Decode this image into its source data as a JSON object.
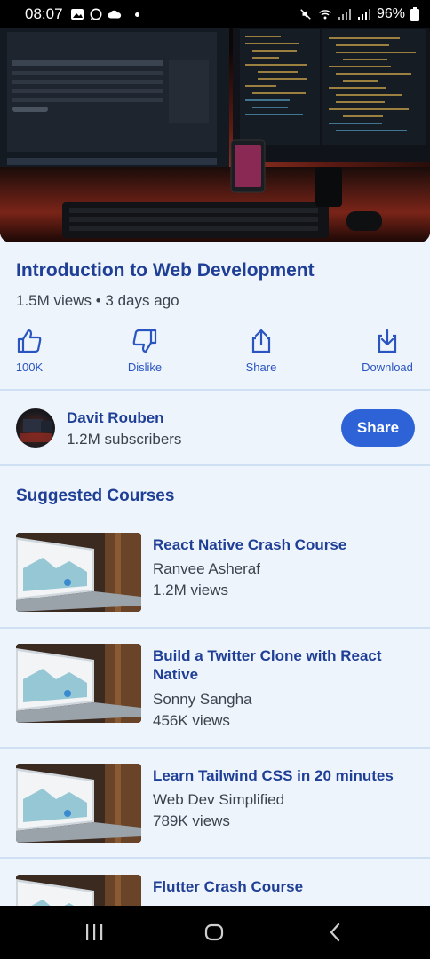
{
  "status_bar": {
    "time": "08:07",
    "battery": "96%"
  },
  "video": {
    "title": "Introduction to Web Development",
    "meta": "1.5M views • 3 days ago"
  },
  "actions": {
    "like_label": "100K",
    "dislike_label": "Dislike",
    "share_label": "Share",
    "download_label": "Download"
  },
  "channel": {
    "name": "Davit Rouben",
    "subscribers": "1.2M subscribers",
    "button_label": "Share"
  },
  "suggested": {
    "title": "Suggested Courses",
    "courses": [
      {
        "title": "React Native Crash Course",
        "author": "Ranvee Asheraf",
        "views": "1.2M views"
      },
      {
        "title": "Build a Twitter Clone with React Native",
        "author": "Sonny Sangha",
        "views": "456K views"
      },
      {
        "title": "Learn Tailwind CSS in 20 minutes",
        "author": "Web Dev Simplified",
        "views": "789K views"
      },
      {
        "title": "Flutter Crash Course",
        "author": "",
        "views": ""
      }
    ]
  },
  "colors": {
    "accent": "#2e63d8",
    "title": "#1f3f96",
    "background": "#eef4fc"
  }
}
